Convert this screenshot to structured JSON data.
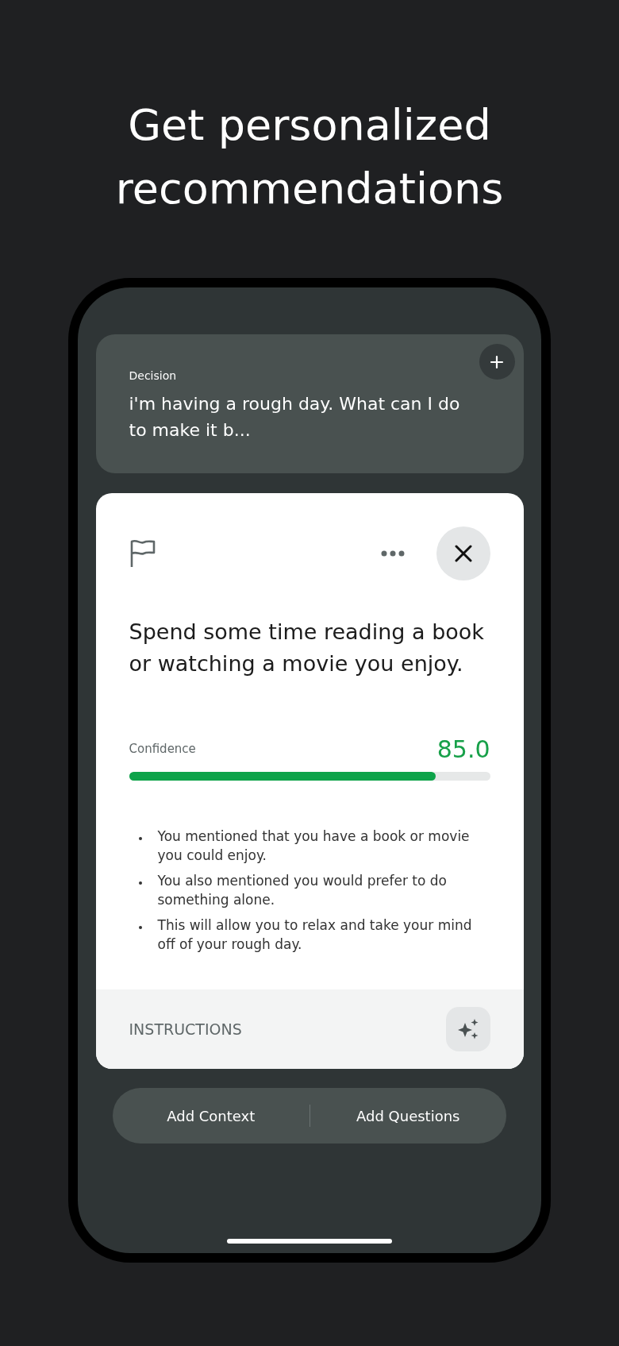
{
  "headline": "Get personalized recommendations",
  "decision": {
    "label": "Decision",
    "text": "i'm having a rough day. What can I do to make it b..."
  },
  "recommendation": {
    "title": "Spend some time reading a book or watching a movie you enjoy.",
    "confidence": {
      "label": "Confidence",
      "reading": "85.0",
      "level": 0.85
    },
    "reasons": [
      "You mentioned that you have a book or movie you could enjoy.",
      "You also mentioned you would prefer to do something alone.",
      "This will allow you to relax and take your mind off of your rough day."
    ],
    "footer": "INSTRUCTIONS"
  },
  "actions": [
    "Add Context",
    "Add Questions"
  ]
}
